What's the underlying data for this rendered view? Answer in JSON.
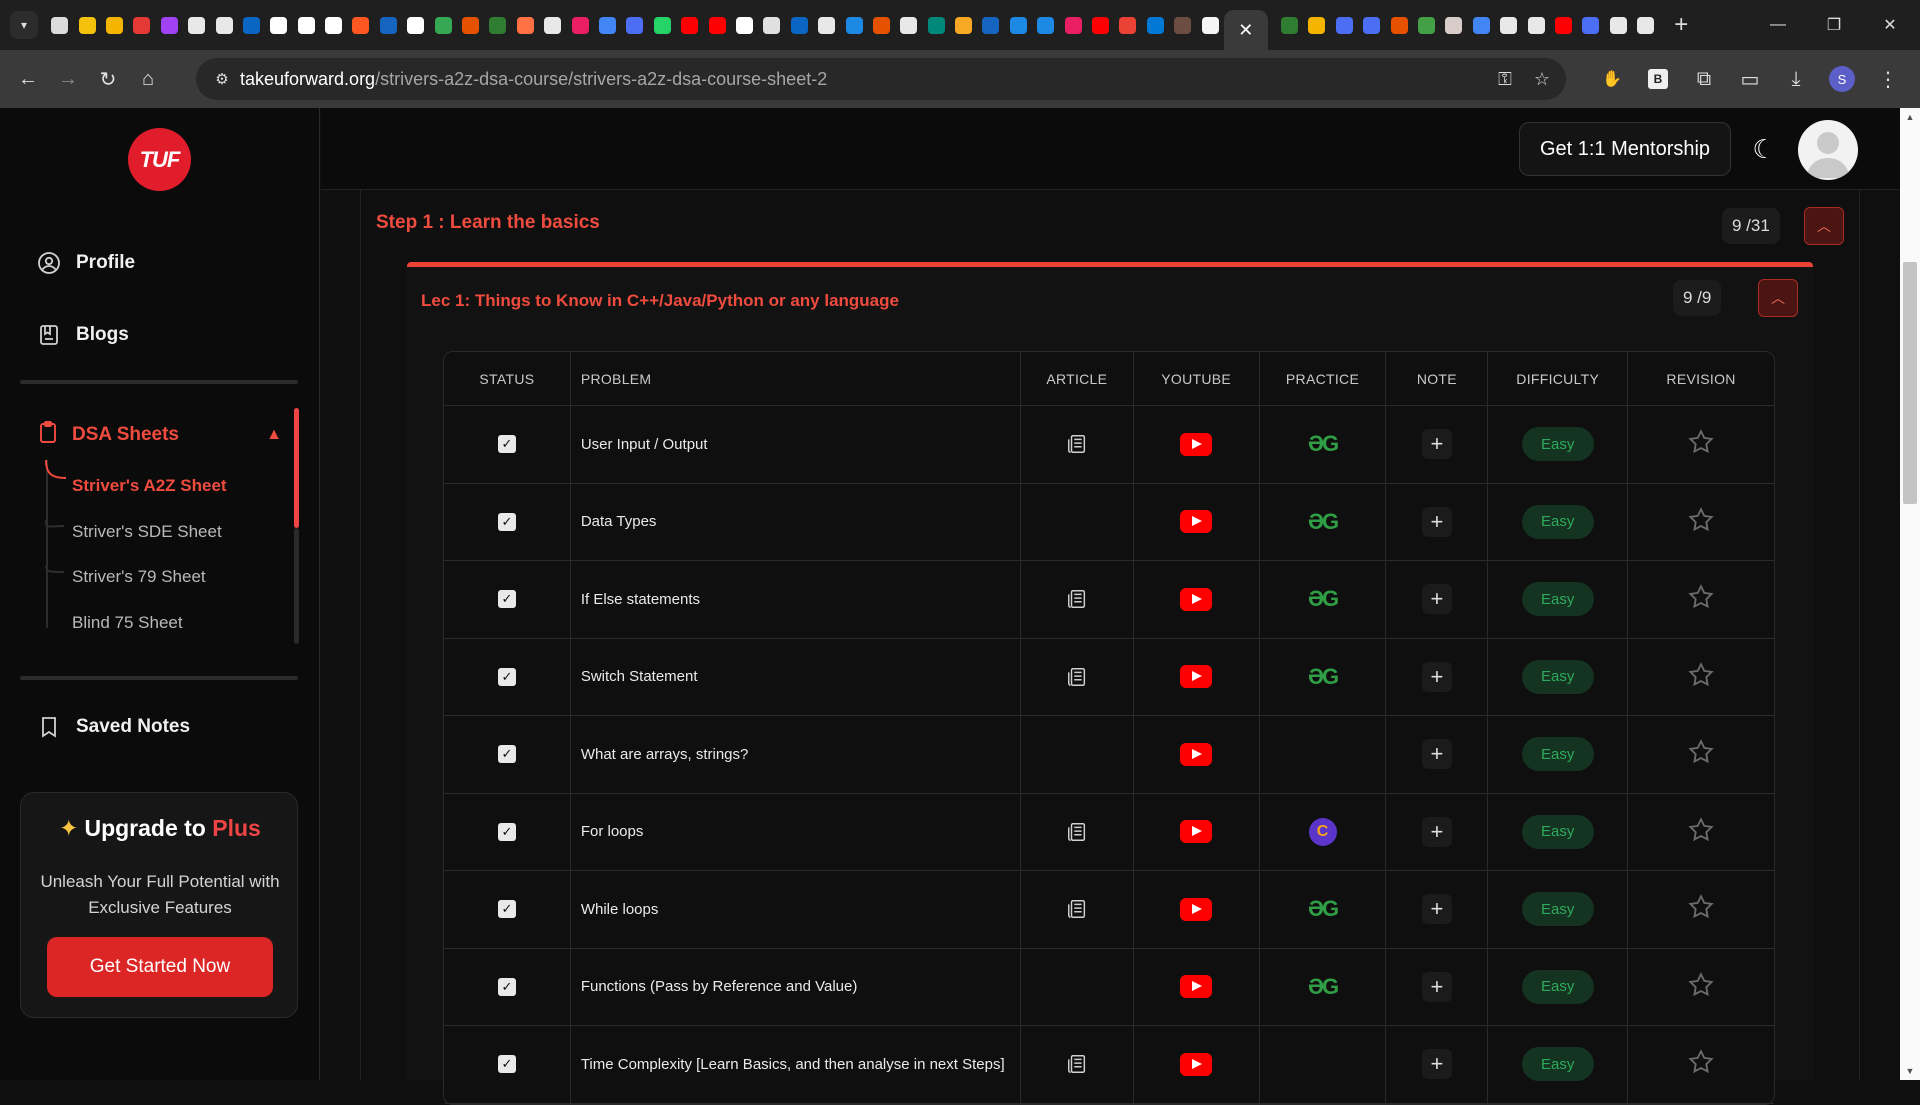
{
  "browser": {
    "url_domain": "takeuforward.org",
    "url_path": "/strivers-a2z-dsa-course/strivers-a2z-dsa-course-sheet-2",
    "profile_initial": "S",
    "extension_letter": "B",
    "tab_favicon_colors": [
      "#dcdcdc",
      "#f4c20d",
      "#f4b400",
      "#e53935",
      "#a142f4",
      "#e8e8e8",
      "#e8e8e8",
      "#0a66c2",
      "#ffffff",
      "#ffffff",
      "#ffffff",
      "#ff5722",
      "#1565c0",
      "#ffffff",
      "#34a853",
      "#e65100",
      "#2e7d32",
      "#ff7043",
      "#e8e8e8",
      "#e91e63",
      "#4285f4",
      "#4c6ef5",
      "#25d366",
      "#ff0000",
      "#ff0000",
      "#ffffff",
      "#e0e0e0",
      "#0a66c2",
      "#e8e8e8",
      "#1e88e5",
      "#e65100",
      "#e8e8e8",
      "#00897b",
      "#f9a825",
      "#1565c0",
      "#1e88e5",
      "#1e88e5",
      "#e91e63",
      "#ff0000",
      "#ea4335",
      "#0078d4",
      "#6d4c41",
      "#f5f5f5"
    ],
    "tab_favicon_colors_after": [
      "#2e7d32",
      "#f4b400",
      "#4c6ef5",
      "#4c6ef5",
      "#e65100",
      "#43a047",
      "#d7ccc8",
      "#4285f4",
      "#e8e8e8",
      "#e8e8e8",
      "#ff0000",
      "#4c6ef5",
      "#e8e8e8",
      "#e8e8e8"
    ],
    "active_tab_close": "✕",
    "new_tab_label": "+"
  },
  "sidebar": {
    "logo_text": "TUF",
    "profile_label": "Profile",
    "blogs_label": "Blogs",
    "dsa_sheets_label": "DSA Sheets",
    "sheets": [
      "Striver's A2Z Sheet",
      "Striver's SDE Sheet",
      "Striver's 79 Sheet",
      "Blind 75 Sheet"
    ],
    "saved_notes_label": "Saved Notes",
    "upgrade": {
      "title": "Upgrade to",
      "title_highlight": "Plus",
      "description": "Unleash Your Full Potential with Exclusive Features",
      "button": "Get Started Now"
    }
  },
  "header": {
    "mentorship_button": "Get 1:1 Mentorship"
  },
  "step": {
    "title": "Step 1 : Learn the basics",
    "progress": "9 /31"
  },
  "lecture": {
    "title": "Lec 1: Things to Know in C++/Java/Python or any language",
    "progress": "9 /9"
  },
  "table": {
    "headers": [
      "STATUS",
      "PROBLEM",
      "ARTICLE",
      "YOUTUBE",
      "PRACTICE",
      "NOTE",
      "DIFFICULTY",
      "REVISION"
    ],
    "rows": [
      {
        "problem": "User Input / Output",
        "article": true,
        "practice": "gfg",
        "difficulty": "Easy"
      },
      {
        "problem": "Data Types",
        "article": false,
        "practice": "gfg",
        "difficulty": "Easy"
      },
      {
        "problem": "If Else statements",
        "article": true,
        "practice": "gfg",
        "difficulty": "Easy"
      },
      {
        "problem": "Switch Statement",
        "article": true,
        "practice": "gfg",
        "difficulty": "Easy"
      },
      {
        "problem": "What are arrays, strings?",
        "article": false,
        "practice": "none",
        "difficulty": "Easy"
      },
      {
        "problem": "For loops",
        "article": true,
        "practice": "codingninjas",
        "difficulty": "Easy"
      },
      {
        "problem": "While loops",
        "article": true,
        "practice": "gfg",
        "difficulty": "Easy"
      },
      {
        "problem": "Functions (Pass by Reference and Value)",
        "article": false,
        "practice": "gfg",
        "difficulty": "Easy"
      },
      {
        "problem": "Time Complexity [Learn Basics, and then analyse in next Steps]",
        "article": true,
        "practice": "none",
        "difficulty": "Easy"
      }
    ]
  },
  "colors": {
    "accent": "#ef4b3f",
    "easy_text": "#2eaa5c",
    "easy_bg": "#143321",
    "gfg_green": "#2f9e44",
    "youtube_red": "#ff0000"
  }
}
